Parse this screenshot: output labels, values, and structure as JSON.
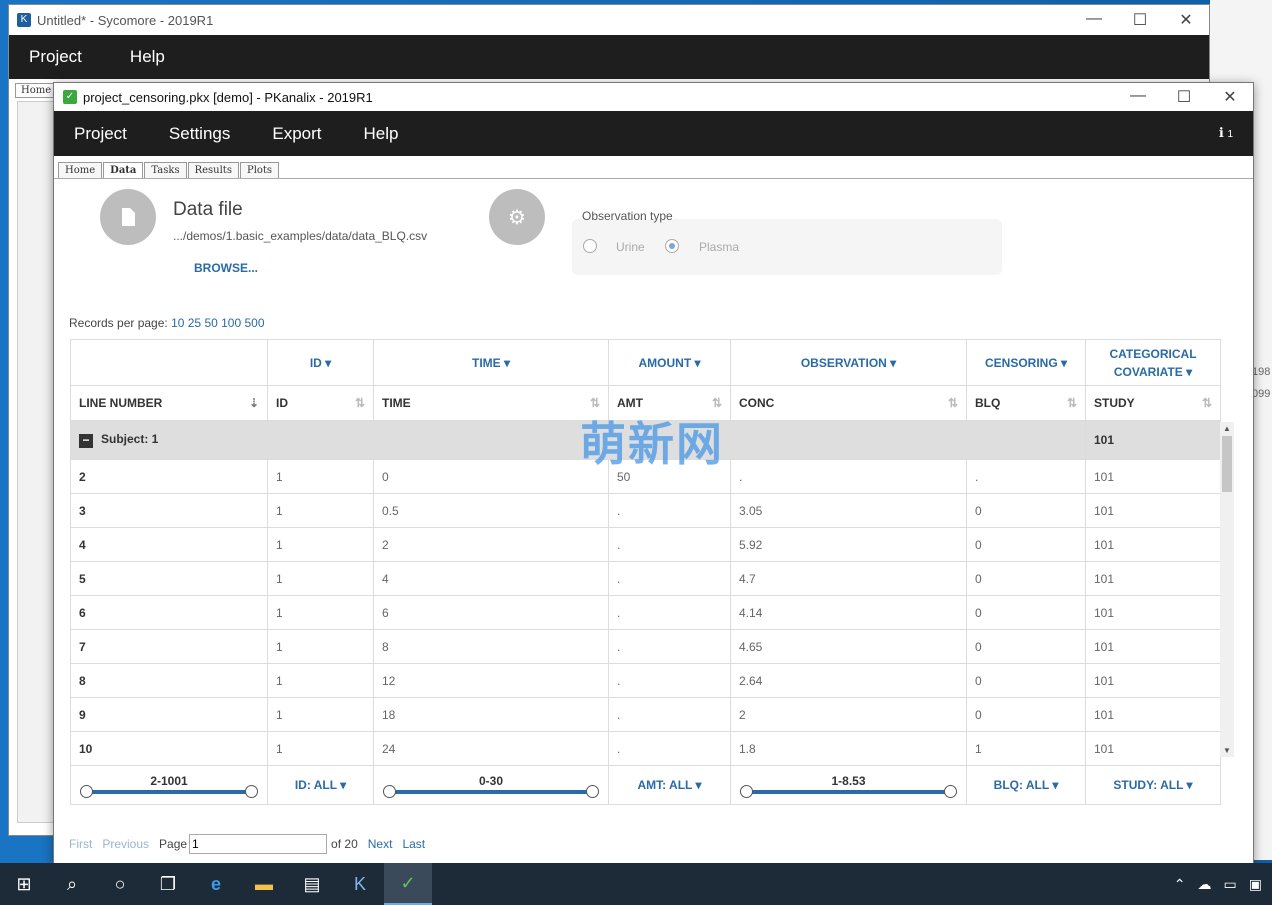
{
  "background_window": {
    "title": "Untitled* - Sycomore - 2019R1",
    "menu": [
      "Project",
      "Help"
    ],
    "home_tab": "Home",
    "right_labels": [
      "198",
      "099"
    ]
  },
  "window": {
    "title": "project_censoring.pkx [demo]  - PKanalix - 2019R1",
    "controls": {
      "minimize": "—",
      "maximize": "☐",
      "close": "✕"
    },
    "menu": {
      "project": "Project",
      "settings": "Settings",
      "export": "Export",
      "help": "Help"
    },
    "info_badge": "1",
    "tabs": [
      "Home",
      "Data",
      "Tasks",
      "Results",
      "Plots"
    ],
    "active_tab": "Data"
  },
  "data_file": {
    "title": "Data file",
    "path": ".../demos/1.basic_examples/data/data_BLQ.csv",
    "browse": "BROWSE..."
  },
  "observation_type": {
    "label": "Observation type",
    "options": [
      "Urine",
      "Plasma"
    ],
    "selected": "Plasma"
  },
  "records_per_page": {
    "label": "Records per page:",
    "options": "10 25 50 100 500"
  },
  "table": {
    "types": [
      "",
      "ID ▾",
      "TIME ▾",
      "AMOUNT ▾",
      "OBSERVATION ▾",
      "CENSORING ▾",
      "CATEGORICAL COVARIATE ▾"
    ],
    "headers": [
      "LINE NUMBER",
      "ID",
      "TIME",
      "AMT",
      "CONC",
      "BLQ",
      "STUDY"
    ],
    "group": {
      "label": "Subject: 1",
      "study": "101"
    },
    "rows": [
      [
        "2",
        "1",
        "0",
        "50",
        ".",
        ".",
        "101"
      ],
      [
        "3",
        "1",
        "0.5",
        ".",
        "3.05",
        "0",
        "101"
      ],
      [
        "4",
        "1",
        "2",
        ".",
        "5.92",
        "0",
        "101"
      ],
      [
        "5",
        "1",
        "4",
        ".",
        "4.7",
        "0",
        "101"
      ],
      [
        "6",
        "1",
        "6",
        ".",
        "4.14",
        "0",
        "101"
      ],
      [
        "7",
        "1",
        "8",
        ".",
        "4.65",
        "0",
        "101"
      ],
      [
        "8",
        "1",
        "12",
        ".",
        "2.64",
        "0",
        "101"
      ],
      [
        "9",
        "1",
        "18",
        ".",
        "2",
        "0",
        "101"
      ],
      [
        "10",
        "1",
        "24",
        ".",
        "1.8",
        "1",
        "101"
      ]
    ],
    "filters": {
      "line_range": "2-1001",
      "id": "ID: ALL ▾",
      "time_range": "0-30",
      "amt": "AMT: ALL ▾",
      "conc_range": "1-8.53",
      "blq": "BLQ: ALL ▾",
      "study": "STUDY: ALL ▾"
    }
  },
  "pager": {
    "first": "First",
    "previous": "Previous",
    "page_label": "Page",
    "page_value": "1",
    "of": "of 20",
    "next": "Next",
    "last": "Last"
  },
  "watermark": "萌新网"
}
